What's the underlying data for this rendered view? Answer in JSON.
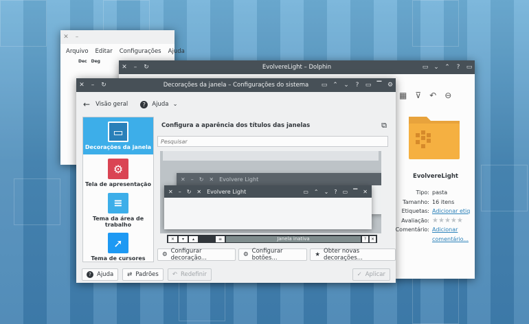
{
  "back_window": {
    "menu": [
      "Arquivo",
      "Editar",
      "Configurações",
      "Ajuda"
    ],
    "cols": [
      "Dec",
      "Deg"
    ]
  },
  "dolphin": {
    "title": "EvolvereLight – Dolphin",
    "folder_name": "EvolvereLight",
    "info": [
      {
        "label": "Tipo:",
        "value": "pasta"
      },
      {
        "label": "Tamanho:",
        "value": "16 itens"
      },
      {
        "label": "Etiquetas:",
        "value": "Adicionar etiq"
      },
      {
        "label": "Avaliação:",
        "value": ""
      },
      {
        "label": "Comentário:",
        "value": "Adicionar comentário..."
      }
    ]
  },
  "settings": {
    "title": "Decorações da janela – Configurações do sistema",
    "back_label": "Visão geral",
    "help_label": "Ajuda",
    "categories": [
      {
        "label": "Decorações da janela",
        "icon": "window-icon",
        "color": "#2980b9"
      },
      {
        "label": "Tela de apresentação",
        "icon": "gear-icon",
        "color": "#da4453"
      },
      {
        "label": "Tema da área de trabalho",
        "icon": "brush-icon",
        "color": "#3daee9"
      },
      {
        "label": "Tema de cursores",
        "icon": "cursor-icon",
        "color": "#1d99f3"
      }
    ],
    "heading": "Configura a aparência dos títulos das janelas",
    "search_placeholder": "Pesquisar",
    "preview_inactive_title": "Evolvere Light",
    "preview_active_title": "Evolvere Light",
    "preview_strip_label": "Janela inativa",
    "buttons": [
      "Configurar decoração...",
      "Configurar botões...",
      "Obter novas decorações..."
    ],
    "footer": {
      "help": "Ajuda",
      "defaults": "Padrões",
      "reset": "Redefinir",
      "apply": "Aplicar"
    }
  }
}
